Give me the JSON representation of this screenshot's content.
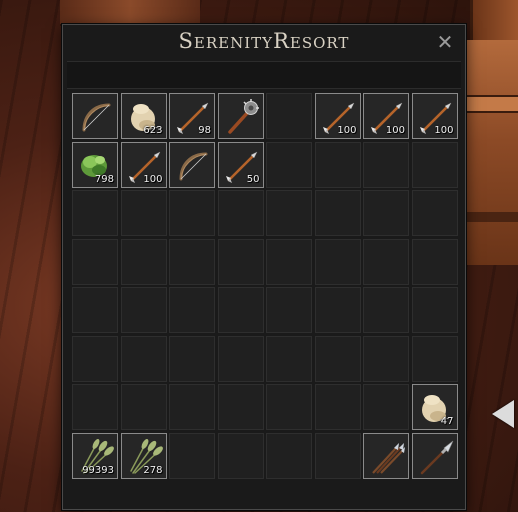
{
  "window": {
    "title": "SerenityResort",
    "close_icon": "close-icon"
  },
  "colors": {
    "wood": "#6a3418",
    "panel": "#1a1a1a",
    "slot_border_filled": "#8a8a8a",
    "title_text": "#d9d2c4"
  },
  "inventory": {
    "columns": 8,
    "rows": 8,
    "items": [
      {
        "row": 0,
        "col": 0,
        "icon": "bow-icon",
        "qty": ""
      },
      {
        "row": 0,
        "col": 1,
        "icon": "cloth-pouch-icon",
        "qty": "623"
      },
      {
        "row": 0,
        "col": 2,
        "icon": "arrow-icon",
        "qty": "98"
      },
      {
        "row": 0,
        "col": 3,
        "icon": "mace-icon",
        "qty": ""
      },
      {
        "row": 0,
        "col": 5,
        "icon": "arrow-icon",
        "qty": "100"
      },
      {
        "row": 0,
        "col": 6,
        "icon": "arrow-icon",
        "qty": "100"
      },
      {
        "row": 0,
        "col": 7,
        "icon": "arrow-icon",
        "qty": "100"
      },
      {
        "row": 1,
        "col": 0,
        "icon": "plant-fiber-icon",
        "qty": "798"
      },
      {
        "row": 1,
        "col": 1,
        "icon": "arrow-icon",
        "qty": "100"
      },
      {
        "row": 1,
        "col": 2,
        "icon": "bow-icon",
        "qty": ""
      },
      {
        "row": 1,
        "col": 3,
        "icon": "arrow-icon",
        "qty": "50"
      },
      {
        "row": 6,
        "col": 7,
        "icon": "cloth-pouch-icon",
        "qty": "47"
      },
      {
        "row": 7,
        "col": 0,
        "icon": "wheat-bundle-icon",
        "qty": "99393"
      },
      {
        "row": 7,
        "col": 1,
        "icon": "wheat-bundle-icon",
        "qty": "278"
      },
      {
        "row": 7,
        "col": 6,
        "icon": "triple-spear-icon",
        "qty": ""
      },
      {
        "row": 7,
        "col": 7,
        "icon": "spear-icon",
        "qty": ""
      }
    ]
  }
}
